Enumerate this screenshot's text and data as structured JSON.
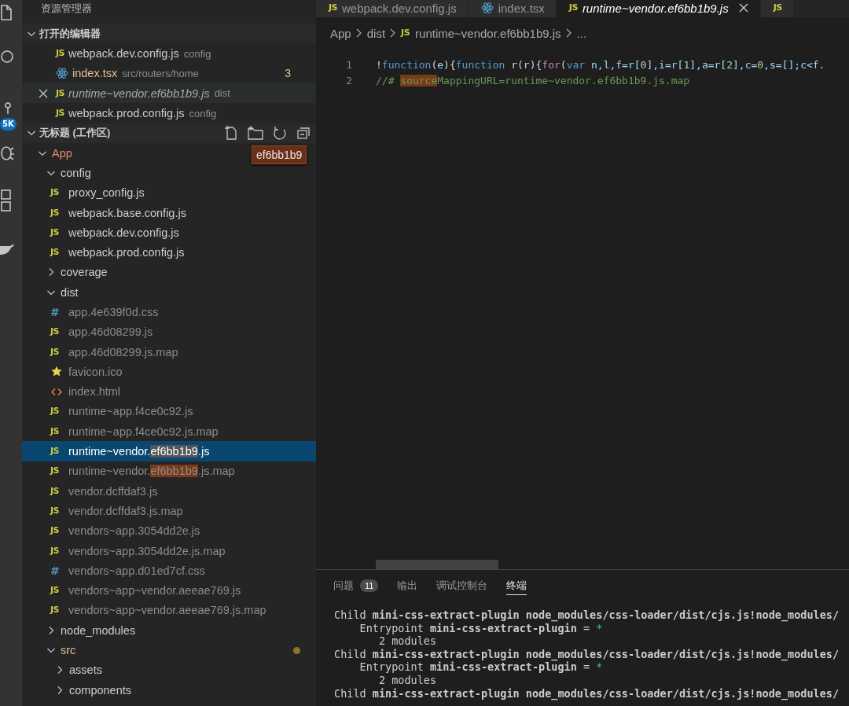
{
  "activity_bar": {
    "badge": "5K"
  },
  "explorer": {
    "title": "资源管理器",
    "open_editors": {
      "title": "打开的编辑器",
      "expanded": true,
      "items": [
        {
          "kind": "js",
          "icon_text": "JS",
          "name": "webpack.dev.config.js",
          "description": "config",
          "color": "#cccccc",
          "preview": false,
          "hovered": false
        },
        {
          "kind": "react",
          "name": "index.tsx",
          "description": "src/routers/home",
          "color": "#e2c08d",
          "preview": false,
          "hovered": false,
          "badge": "3"
        },
        {
          "kind": "js",
          "icon_text": "JS",
          "name": "runtime~vendor.ef6bb1b9.js",
          "description": "dist",
          "color": "#a8a8a8",
          "preview": true,
          "hovered": true
        },
        {
          "kind": "js",
          "icon_text": "JS",
          "name": "webpack.prod.config.js",
          "description": "config",
          "color": "#cccccc",
          "preview": false,
          "hovered": false
        }
      ]
    },
    "workspace": {
      "title": "无标题 (工作区)",
      "expanded": true,
      "tooltip": "ef6bb1b9",
      "tree": [
        {
          "kind": "folder",
          "name": "App",
          "color": "#f48771",
          "expanded": true,
          "selected": false,
          "children": [
            {
              "kind": "folder",
              "name": "config",
              "color": "#cccccc",
              "expanded": true,
              "selected": false,
              "children": [
                {
                  "kind": "js",
                  "icon_text": "JS",
                  "name": "proxy_config.js",
                  "color": "#cccccc",
                  "selected": false
                },
                {
                  "kind": "js",
                  "icon_text": "JS",
                  "name": "webpack.base.config.js",
                  "color": "#cccccc",
                  "selected": false
                },
                {
                  "kind": "js",
                  "icon_text": "JS",
                  "name": "webpack.dev.config.js",
                  "color": "#cccccc",
                  "selected": false
                },
                {
                  "kind": "js",
                  "icon_text": "JS",
                  "name": "webpack.prod.config.js",
                  "color": "#cccccc",
                  "selected": false
                }
              ]
            },
            {
              "kind": "folder",
              "name": "coverage",
              "color": "#cccccc",
              "expanded": false,
              "selected": false
            },
            {
              "kind": "folder",
              "name": "dist",
              "color": "#cccccc",
              "expanded": true,
              "selected": false,
              "children": [
                {
                  "kind": "css",
                  "icon_text": "#",
                  "name": "app.4e639f0d.css",
                  "color": "#8c8c8c",
                  "selected": false
                },
                {
                  "kind": "js",
                  "icon_text": "JS",
                  "name": "app.46d08299.js",
                  "color": "#8c8c8c",
                  "selected": false
                },
                {
                  "kind": "js",
                  "icon_text": "JS",
                  "name": "app.46d08299.js.map",
                  "color": "#8c8c8c",
                  "selected": false
                },
                {
                  "kind": "star",
                  "name": "favicon.ico",
                  "color": "#8c8c8c",
                  "selected": false
                },
                {
                  "kind": "html",
                  "name": "index.html",
                  "color": "#8c8c8c",
                  "selected": false
                },
                {
                  "kind": "js",
                  "icon_text": "JS",
                  "name": "runtime~app.f4ce0c92.js",
                  "color": "#8c8c8c",
                  "selected": false
                },
                {
                  "kind": "js",
                  "icon_text": "JS",
                  "name": "runtime~app.f4ce0c92.js.map",
                  "color": "#8c8c8c",
                  "selected": false
                },
                {
                  "kind": "js",
                  "icon_text": "JS",
                  "name_parts": [
                    {
                      "text": "runtime~vendor.",
                      "match": false
                    },
                    {
                      "text": "ef6bb1b9",
                      "match": true
                    },
                    {
                      "text": ".js",
                      "match": false
                    }
                  ],
                  "color": "#ffffff",
                  "selected": true
                },
                {
                  "kind": "js",
                  "icon_text": "JS",
                  "name_parts": [
                    {
                      "text": "runtime~vendor.",
                      "match": false
                    },
                    {
                      "text": "ef6bb1b9",
                      "match": true
                    },
                    {
                      "text": ".js.map",
                      "match": false
                    }
                  ],
                  "color": "#8c8c8c",
                  "selected": false
                },
                {
                  "kind": "js",
                  "icon_text": "JS",
                  "name": "vendor.dcffdaf3.js",
                  "color": "#8c8c8c",
                  "selected": false
                },
                {
                  "kind": "js",
                  "icon_text": "JS",
                  "name": "vendor.dcffdaf3.js.map",
                  "color": "#8c8c8c",
                  "selected": false
                },
                {
                  "kind": "js",
                  "icon_text": "JS",
                  "name": "vendors~app.3054dd2e.js",
                  "color": "#8c8c8c",
                  "selected": false
                },
                {
                  "kind": "js",
                  "icon_text": "JS",
                  "name": "vendors~app.3054dd2e.js.map",
                  "color": "#8c8c8c",
                  "selected": false
                },
                {
                  "kind": "css",
                  "icon_text": "#",
                  "name": "vendors~app.d01ed7cf.css",
                  "color": "#8c8c8c",
                  "selected": false
                },
                {
                  "kind": "js",
                  "icon_text": "JS",
                  "name": "vendors~app~vendor.aeeae769.js",
                  "color": "#8c8c8c",
                  "selected": false
                },
                {
                  "kind": "js",
                  "icon_text": "JS",
                  "name": "vendors~app~vendor.aeeae769.js.map",
                  "color": "#8c8c8c",
                  "selected": false
                }
              ]
            },
            {
              "kind": "folder",
              "name": "node_modules",
              "color": "#cccccc",
              "expanded": false,
              "selected": false
            },
            {
              "kind": "folder",
              "name": "src",
              "color": "#e2c08d",
              "expanded": true,
              "selected": false,
              "modified": true,
              "children": [
                {
                  "kind": "folder",
                  "name": "assets",
                  "color": "#cccccc",
                  "expanded": false,
                  "selected": false
                },
                {
                  "kind": "folder",
                  "name": "components",
                  "color": "#cccccc",
                  "expanded": false,
                  "selected": false
                }
              ]
            }
          ]
        }
      ]
    }
  },
  "editor": {
    "tabs": [
      {
        "kind": "js",
        "icon_text": "JS",
        "label": "webpack.dev.config.js",
        "selected": false,
        "preview": false
      },
      {
        "kind": "react",
        "label": "index.tsx",
        "selected": false,
        "preview": false
      },
      {
        "kind": "js",
        "icon_text": "JS",
        "label": "runtime~vendor.ef6bb1b9.js",
        "selected": true,
        "preview": true
      },
      {
        "kind": "js",
        "icon_text": "JS",
        "selected": false,
        "preview": false
      }
    ],
    "breadcrumbs": [
      {
        "kind": "folder",
        "text": "App"
      },
      {
        "kind": "folder",
        "text": "dist"
      },
      {
        "kind": "js",
        "icon_text": "JS",
        "text": "runtime~vendor.ef6bb1b9.js"
      },
      {
        "kind": "folder",
        "text": "..."
      }
    ],
    "lines": [
      {
        "number": "1",
        "tokens": [
          {
            "text": "!",
            "kind": "plain",
            "match": false
          },
          {
            "text": "function",
            "kind": "keyword",
            "match": false
          },
          {
            "text": "(",
            "kind": "plain",
            "match": false
          },
          {
            "text": "e",
            "kind": "var",
            "match": false
          },
          {
            "text": "){",
            "kind": "plain",
            "match": false
          },
          {
            "text": "function",
            "kind": "keyword",
            "match": false
          },
          {
            "text": " r(r){",
            "kind": "plain",
            "match": false
          },
          {
            "text": "for",
            "kind": "control",
            "match": false
          },
          {
            "text": "(",
            "kind": "plain",
            "match": false
          },
          {
            "text": "var",
            "kind": "keyword",
            "match": false
          },
          {
            "text": " n,l,f=r[",
            "kind": "var",
            "match": false
          },
          {
            "text": "0",
            "kind": "number",
            "match": false
          },
          {
            "text": "],i=r[",
            "kind": "var",
            "match": false
          },
          {
            "text": "1",
            "kind": "number",
            "match": false
          },
          {
            "text": "],a=r[",
            "kind": "var",
            "match": false
          },
          {
            "text": "2",
            "kind": "number",
            "match": false
          },
          {
            "text": "],c=",
            "kind": "var",
            "match": false
          },
          {
            "text": "0",
            "kind": "number",
            "match": false
          },
          {
            "text": ",s=[];c<f.",
            "kind": "var",
            "match": false
          }
        ]
      },
      {
        "number": "2",
        "tokens": [
          {
            "text": "//# ",
            "kind": "comment",
            "match": false
          },
          {
            "text": "source",
            "kind": "comment",
            "match": true
          },
          {
            "text": "MappingURL=runtime~vendor.ef6bb1b9.js.map",
            "kind": "comment",
            "match": false
          }
        ]
      }
    ]
  },
  "panel": {
    "tabs": [
      {
        "label": "问题",
        "badge": "11",
        "selected": false
      },
      {
        "label": "输出",
        "selected": false
      },
      {
        "label": "调试控制台",
        "selected": false
      },
      {
        "label": "终端",
        "selected": true
      }
    ],
    "terminal": [
      [
        {
          "text": "Child ",
          "kind": "plain"
        },
        {
          "text": "mini-css-extract-plugin node_modules/css-loader/dist/cjs.js!node_modules/",
          "kind": "bold"
        }
      ],
      [
        {
          "text": "    Entrypoint ",
          "kind": "plain"
        },
        {
          "text": "mini-css-extract-plugin",
          "kind": "bold"
        },
        {
          "text": " = ",
          "kind": "plain"
        },
        {
          "text": "*",
          "kind": "green"
        }
      ],
      [
        {
          "text": "       2 modules",
          "kind": "plain"
        }
      ],
      [
        {
          "text": "Child ",
          "kind": "plain"
        },
        {
          "text": "mini-css-extract-plugin node_modules/css-loader/dist/cjs.js!node_modules/",
          "kind": "bold"
        }
      ],
      [
        {
          "text": "    Entrypoint ",
          "kind": "plain"
        },
        {
          "text": "mini-css-extract-plugin",
          "kind": "bold"
        },
        {
          "text": " = ",
          "kind": "plain"
        },
        {
          "text": "*",
          "kind": "green"
        }
      ],
      [
        {
          "text": "       2 modules",
          "kind": "plain"
        }
      ],
      [
        {
          "text": "Child ",
          "kind": "plain"
        },
        {
          "text": "mini-css-extract-plugin node_modules/css-loader/dist/cjs.js!node_modules/",
          "kind": "bold"
        }
      ]
    ]
  }
}
